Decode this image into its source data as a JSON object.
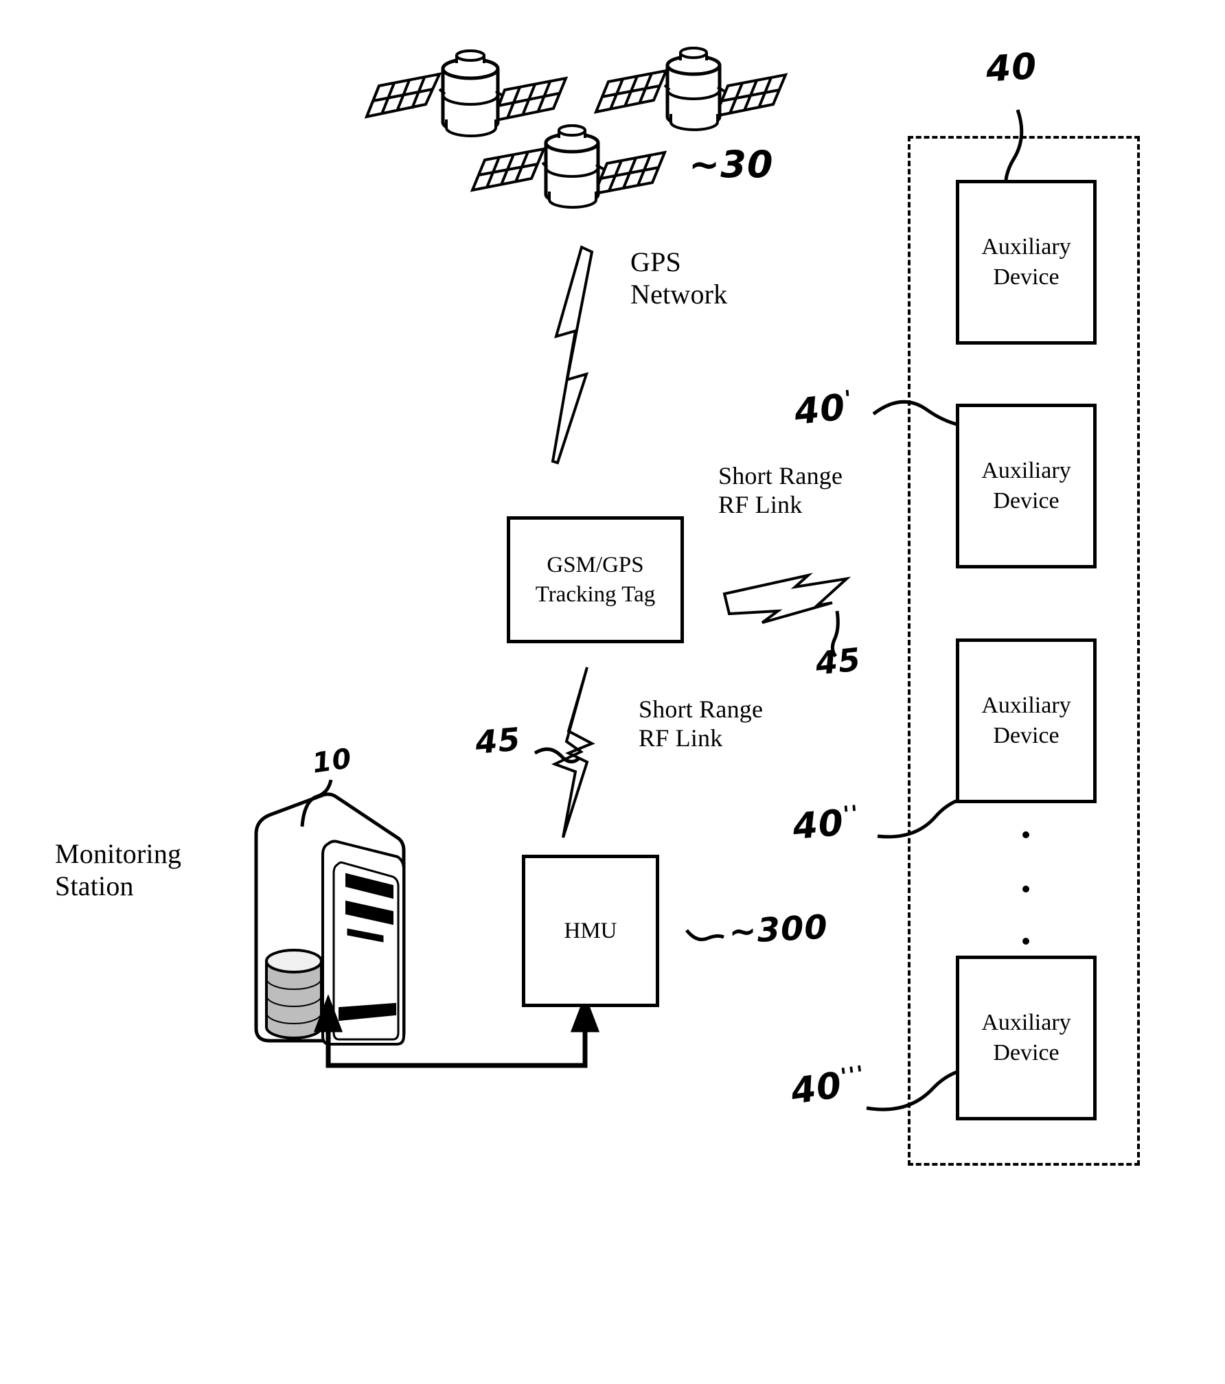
{
  "figure": {
    "type": "patent-system-diagram",
    "background_color": "#ffffff",
    "line_color": "#000000"
  },
  "satellites": {
    "count": 3,
    "icon_name": "satellite-icon",
    "reference_numeral": "~30"
  },
  "labels": {
    "gps_network": "GPS\nNetwork",
    "short_range_rf_link_upper": "Short Range\nRF Link",
    "short_range_rf_link_lower": "Short Range\nRF Link",
    "monitoring_station": "Monitoring\nStation"
  },
  "boxes": {
    "tracking_tag": {
      "text": "GSM/GPS\nTracking Tag"
    },
    "hmu": {
      "text": "HMU",
      "reference_numeral": "300",
      "reference_prefix": "~"
    }
  },
  "auxiliary_group": {
    "reference_numeral": "40",
    "items": [
      {
        "text": "Auxiliary\nDevice",
        "reference_numeral": "40"
      },
      {
        "text": "Auxiliary\nDevice",
        "reference_numeral": "40",
        "prime": "'"
      },
      {
        "text": "Auxiliary\nDevice",
        "reference_numeral": "40",
        "prime": "''"
      },
      {
        "text": "Auxiliary\nDevice",
        "reference_numeral": "40",
        "prime": "'''"
      }
    ],
    "ellipsis_dots": 3
  },
  "monitoring_station": {
    "reference_numeral": "10",
    "icon_name": "computer-tower-icon"
  },
  "rf_links": {
    "upper_bolt_numeral": "45",
    "lower_bolt_numeral": "45",
    "lower_bolt_prefix": "~"
  }
}
